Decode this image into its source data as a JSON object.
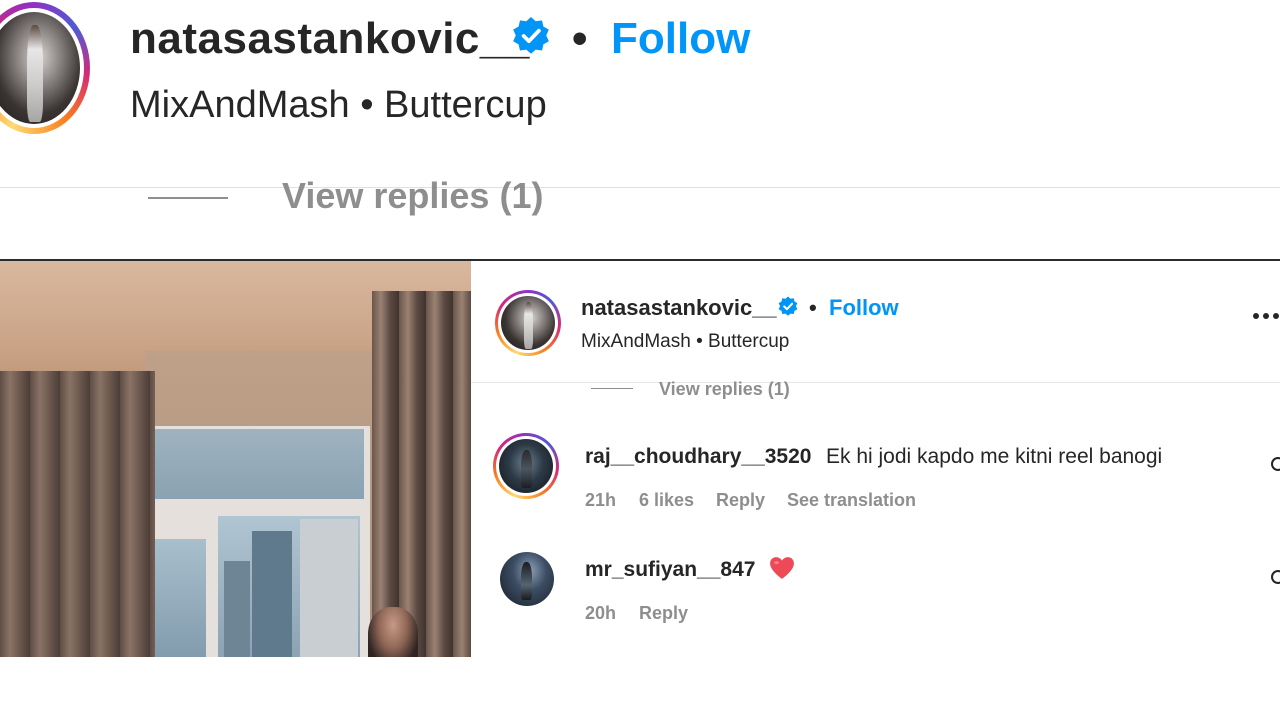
{
  "header": {
    "username": "natasastankovic__",
    "follow_label": "Follow",
    "separator": "•",
    "audio_text": "MixAndMash • Buttercup",
    "view_replies": "View replies (1)"
  },
  "post": {
    "username": "natasastankovic__",
    "follow_label": "Follow",
    "separator": "•",
    "audio_text": "MixAndMash • Buttercup",
    "view_replies": "View replies (1)",
    "more_icon": "more-options-icon"
  },
  "comments": [
    {
      "username": "raj__choudhary__3520",
      "text": "Ek hi jodi kapdo me kitni reel banogi",
      "time": "21h",
      "likes": "6 likes",
      "reply_label": "Reply",
      "translation_label": "See translation"
    },
    {
      "username": "mr_sufiyan__847",
      "emoji_icon": "red-heart-icon",
      "time": "20h",
      "reply_label": "Reply"
    }
  ],
  "colors": {
    "accent": "#0095f6",
    "text": "#262626",
    "muted": "#8e8e8e",
    "heart": "#ed4956"
  }
}
